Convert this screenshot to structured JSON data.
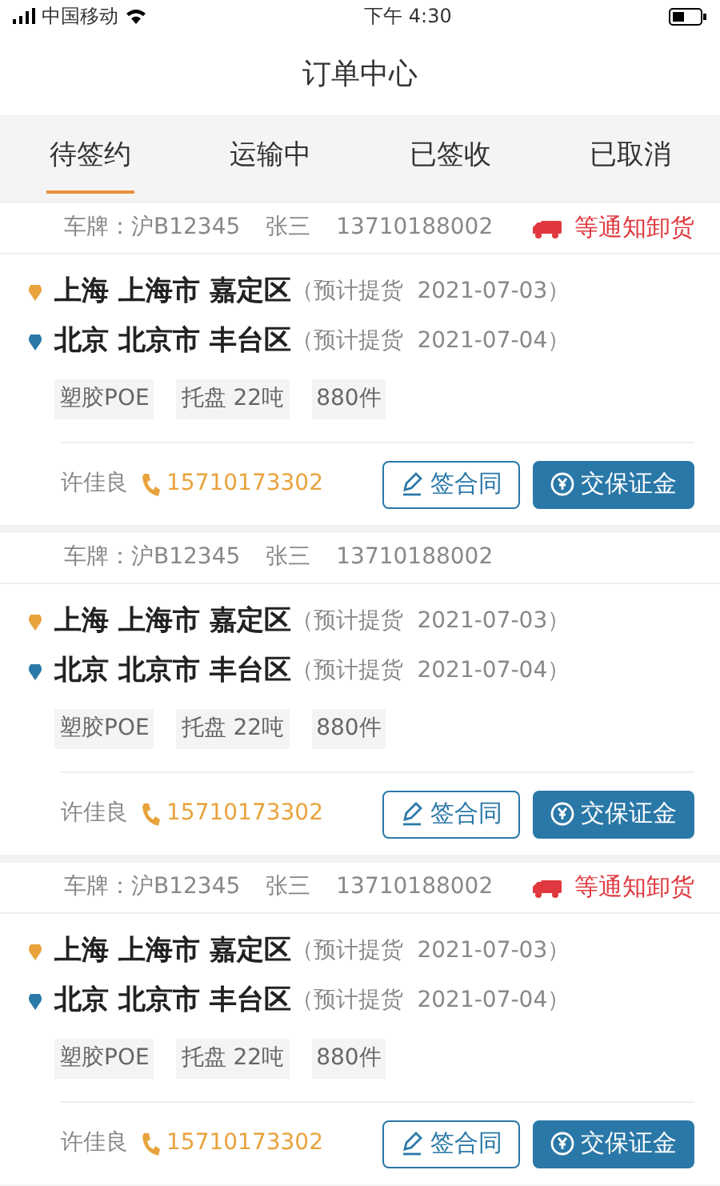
{
  "status_bar": {
    "carrier": "中国移动",
    "time": "下午 4:30"
  },
  "title": "订单中心",
  "tabs": [
    {
      "label": "待签约",
      "selected": true
    },
    {
      "label": "运输中",
      "selected": false
    },
    {
      "label": "已签收",
      "selected": false
    },
    {
      "label": "已取消",
      "selected": false
    }
  ],
  "orders": [
    {
      "plate": "车牌：沪B12345",
      "driver": "张三",
      "driver_phone": "13710188002",
      "status": "等通知卸货",
      "stops": [
        {
          "place": "上海 上海市 嘉定区",
          "note": "（预计提货  2021-07-03）",
          "color": "#e8a33d"
        },
        {
          "place": "北京 北京市 丰台区",
          "note": "（预计提货  2021-07-04）",
          "color": "#2a78a8"
        }
      ],
      "tags": [
        "塑胶POE",
        "托盘 22吨",
        "880件"
      ],
      "contact": "许佳良",
      "contact_phone": "15710173302",
      "buttons": [
        {
          "label": "签合同",
          "kind": "outline"
        },
        {
          "label": "交保证金",
          "kind": "solid"
        }
      ]
    },
    {
      "plate": "车牌：沪B12345",
      "driver": "张三",
      "driver_phone": "13710188002",
      "stops": [
        {
          "place": "上海 上海市 嘉定区",
          "note": "（预计提货  2021-07-03）",
          "color": "#e8a33d"
        },
        {
          "place": "北京 北京市 丰台区",
          "note": "（预计提货  2021-07-04）",
          "color": "#2a78a8"
        }
      ],
      "tags": [
        "塑胶POE",
        "托盘 22吨",
        "880件"
      ],
      "contact": "许佳良",
      "contact_phone": "15710173302",
      "buttons": [
        {
          "label": "签合同",
          "kind": "outline"
        },
        {
          "label": "交保证金",
          "kind": "solid"
        }
      ]
    },
    {
      "plate": "车牌：沪B12345",
      "driver": "张三",
      "driver_phone": "13710188002",
      "status": "等通知卸货",
      "stops": [
        {
          "place": "上海 上海市 嘉定区",
          "note": "（预计提货  2021-07-03）",
          "color": "#e8a33d"
        },
        {
          "place": "北京 北京市 丰台区",
          "note": "（预计提货  2021-07-04）",
          "color": "#2a78a8"
        }
      ],
      "tags": [
        "塑胶POE",
        "托盘 22吨",
        "880件"
      ],
      "contact": "许佳良",
      "contact_phone": "15710173302",
      "buttons": [
        {
          "label": "签合同",
          "kind": "outline"
        },
        {
          "label": "交保证金",
          "kind": "solid"
        }
      ]
    }
  ]
}
